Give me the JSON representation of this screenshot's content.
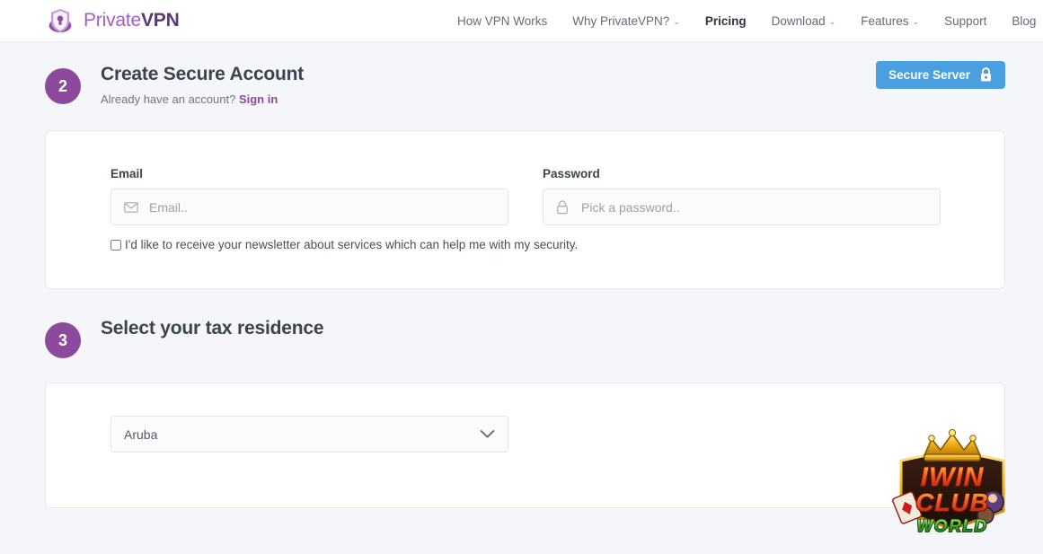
{
  "header": {
    "brand": {
      "name_light": "Private",
      "name_bold": "VPN",
      "icon": "shield-keyhole-logo"
    },
    "nav": [
      {
        "label": "How VPN Works",
        "has_caret": false,
        "active": false
      },
      {
        "label": "Why PrivateVPN?",
        "has_caret": true,
        "active": false
      },
      {
        "label": "Pricing",
        "has_caret": false,
        "active": true
      },
      {
        "label": "Download",
        "has_caret": true,
        "active": false
      },
      {
        "label": "Features",
        "has_caret": true,
        "active": false
      },
      {
        "label": "Support",
        "has_caret": false,
        "active": false
      },
      {
        "label": "Blog",
        "has_caret": false,
        "active": false
      }
    ],
    "caret_glyph": "⌄"
  },
  "step2": {
    "number": "2",
    "title": "Create Secure Account",
    "sub_prefix": "Already have an account?",
    "sign_in_label": "Sign in",
    "secure_button": {
      "label": "Secure Server",
      "icon": "lock-icon"
    },
    "email": {
      "label": "Email",
      "placeholder": "Email..",
      "value": "",
      "icon": "envelope-icon"
    },
    "password": {
      "label": "Password",
      "placeholder": "Pick a password..",
      "value": "",
      "icon": "lock-outline-icon"
    },
    "newsletter": {
      "checked": false,
      "label": "I'd like to receive your newsletter about services which can help me with my security."
    }
  },
  "step3": {
    "number": "3",
    "title": "Select your tax residence",
    "country_select": {
      "value": "Aruba",
      "icon": "chevron-down-icon"
    }
  },
  "overlay": {
    "logo": {
      "line1": "IWIN",
      "line2": "CLUB",
      "line3": "WORLD",
      "name": "iwin-club-world-logo"
    }
  },
  "colors": {
    "brand_purple": "#8b4a9c",
    "accent_blue": "#4a9fe0",
    "page_bg": "#f5f6fa",
    "card_bg": "#ffffff",
    "text_dark": "#3d434f"
  }
}
